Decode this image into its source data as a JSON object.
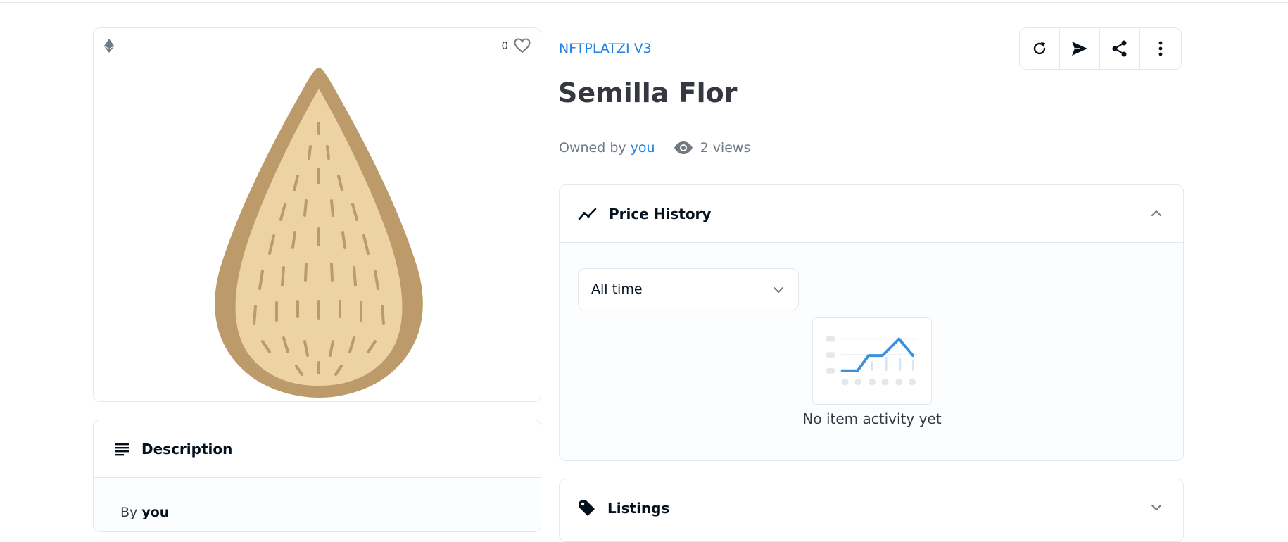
{
  "media": {
    "favorite_count": "0",
    "chain_icon": "ethereum-icon",
    "favorite_icon": "heart-icon",
    "artwork": "almond-seed-illustration"
  },
  "description": {
    "title": "Description",
    "by_prefix": "By",
    "by_user": "you"
  },
  "item": {
    "collection": "NFTPLATZI V3",
    "title": "Semilla Flor",
    "owned_by_prefix": "Owned by",
    "owner": "you",
    "views": "2 views"
  },
  "actions": [
    {
      "icon": "refresh-icon"
    },
    {
      "icon": "send-icon"
    },
    {
      "icon": "share-icon"
    },
    {
      "icon": "more-vertical-icon"
    }
  ],
  "price_history": {
    "title": "Price History",
    "range_selected": "All time",
    "empty_message": "No item activity yet"
  },
  "listings": {
    "title": "Listings"
  },
  "colors": {
    "link": "#2081e2",
    "seed_outer": "#bc9a6a",
    "seed_inner": "#edd2a3",
    "chart_line": "#3d8fe0"
  }
}
